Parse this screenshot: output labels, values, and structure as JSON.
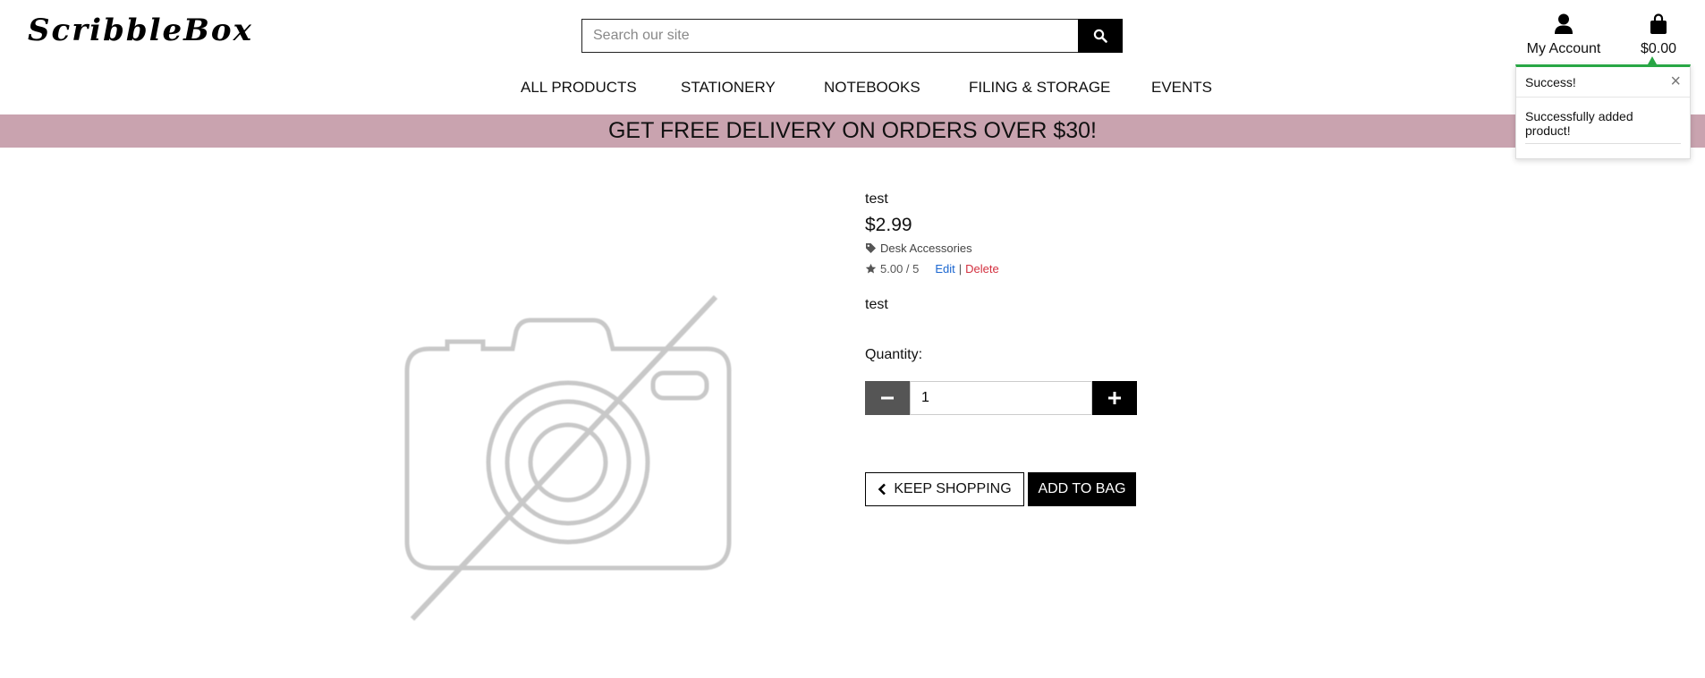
{
  "brand": {
    "logo_text": "ScribbleBox"
  },
  "search": {
    "placeholder": "Search our site",
    "icon": "search-icon"
  },
  "account": {
    "label": "My Account",
    "icon": "user-icon"
  },
  "bag": {
    "total": "$0.00",
    "icon": "shopping-bag-icon"
  },
  "nav": {
    "items": [
      {
        "label": "ALL PRODUCTS"
      },
      {
        "label": "STATIONERY"
      },
      {
        "label": "NOTEBOOKS"
      },
      {
        "label": "FILING & STORAGE"
      },
      {
        "label": "EVENTS"
      }
    ]
  },
  "banner": {
    "text": "GET FREE DELIVERY ON ORDERS OVER $30!",
    "color": "#c9a3af"
  },
  "toast": {
    "title": "Success!",
    "close_symbol": "×",
    "message": "Successfully added product!",
    "accent": "#28a745"
  },
  "product": {
    "name": "test",
    "price": "$2.99",
    "category": "Desk Accessories",
    "category_icon": "tag-icon",
    "rating": "5.00 / 5",
    "rating_icon": "star-icon",
    "edit_label": "Edit",
    "separator": "|",
    "delete_label": "Delete",
    "description": "test",
    "quantity_label": "Quantity:",
    "quantity_value": "1",
    "image_icon": "no-image-camera-icon"
  },
  "buttons": {
    "keep_shopping": "KEEP SHOPPING",
    "add_to_bag": "ADD TO BAG"
  },
  "colors": {
    "edit_link": "#1a66d0",
    "delete_link": "#d3303f"
  }
}
